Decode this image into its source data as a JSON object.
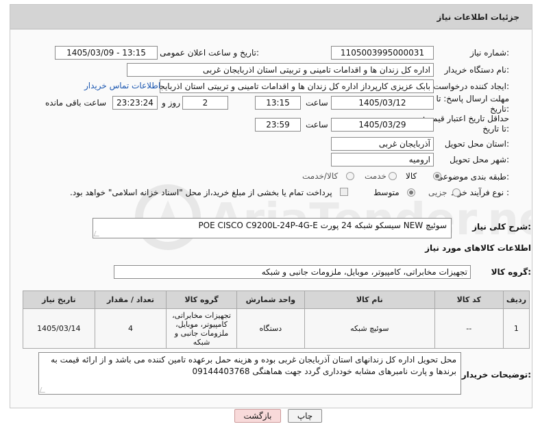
{
  "header": {
    "title": "جزئیات اطلاعات نیاز"
  },
  "fields": {
    "need_number": {
      "label": "شماره نیاز:",
      "value": "1105003995000031"
    },
    "announce_datetime": {
      "label": "تاریخ و ساعت اعلان عمومی:",
      "value": "1405/03/09 - 13:15"
    },
    "buyer_org": {
      "label": "نام دستگاه خریدار:",
      "value": "اداره کل زندان ها و اقدامات تامینی و تربیتی استان اذربایجان غربی"
    },
    "requester": {
      "label": "ایجاد کننده درخواست:",
      "value": "بابک عزیزی کارپرداز اداره کل زندان ها و اقدامات تامینی و تربیتی استان اذربایجان",
      "contact_link": "اطلاعات تماس خریدار"
    },
    "reply_deadline": {
      "label": "مهلت ارسال پاسخ: تا تاریخ:",
      "date": "1405/03/12",
      "time_label": "ساعت",
      "time": "13:15",
      "days": "2",
      "days_label": "روز و",
      "remaining": "23:23:24",
      "remaining_label": "ساعت باقی مانده"
    },
    "price_validity": {
      "label": "حداقل تاریخ اعتبار قیمت: تا تاریخ:",
      "date": "1405/03/29",
      "time_label": "ساعت",
      "time": "23:59"
    },
    "delivery_province": {
      "label": "استان محل تحویل:",
      "value": "آذربایجان غربی"
    },
    "delivery_city": {
      "label": "شهر محل تحویل:",
      "value": "ارومیه"
    },
    "category": {
      "label": "طبقه بندی موضوعی:",
      "options": [
        "کالا",
        "خدمت",
        "کالا/خدمت"
      ],
      "selected": "کالا"
    },
    "process_type": {
      "label": "نوع فرآیند خرید :",
      "options": [
        "جزیی",
        "متوسط"
      ],
      "selected": "متوسط",
      "note": "پرداخت تمام یا بخشی از مبلغ خرید،از محل \"اسناد خزانه اسلامی\" خواهد بود."
    }
  },
  "description": {
    "label": "شرح کلی نیاز:",
    "value": "سوئیچ NEW سیسکو شبکه 24 پورت POE CISCO C9200L-24P-4G-E"
  },
  "goods_info": {
    "title": "اطلاعات کالاهای مورد نیاز"
  },
  "goods_group": {
    "label": "گروه کالا:",
    "value": "تجهیزات مخابراتی، کامپیوتر، موبایل، ملزومات جانبی و شبکه"
  },
  "table": {
    "headers": [
      "ردیف",
      "کد کالا",
      "نام کالا",
      "واحد شمارش",
      "گروه کالا",
      "تعداد / مقدار",
      "تاریخ نیاز"
    ],
    "rows": [
      {
        "row": "1",
        "code": "--",
        "name": "سوئیچ شبکه",
        "unit": "دستگاه",
        "group": "تجهیزات مخابراتی، کامپیوتر، موبایل، ملزومات جانبی و شبکه",
        "qty": "4",
        "date": "1405/03/14"
      }
    ]
  },
  "buyer_notes": {
    "label": "توضیحات خریدار:",
    "value": "محل تحویل اداره کل زندانهای استان آذربایجان غربی بوده و هزینه حمل  برعهده تامین کننده می باشد و از ارائه قیمت به برندها و پارت نامبرهای مشابه  خودداری گردد جهت هماهنگی 09144403768"
  },
  "buttons": {
    "print": "چاپ",
    "back": "بازگشت"
  },
  "watermark": {
    "text": "AriaTender.net"
  },
  "colors": {
    "header_bg": "#d4d4d4",
    "link": "#1a56b0",
    "back_button": "#f8dada"
  }
}
